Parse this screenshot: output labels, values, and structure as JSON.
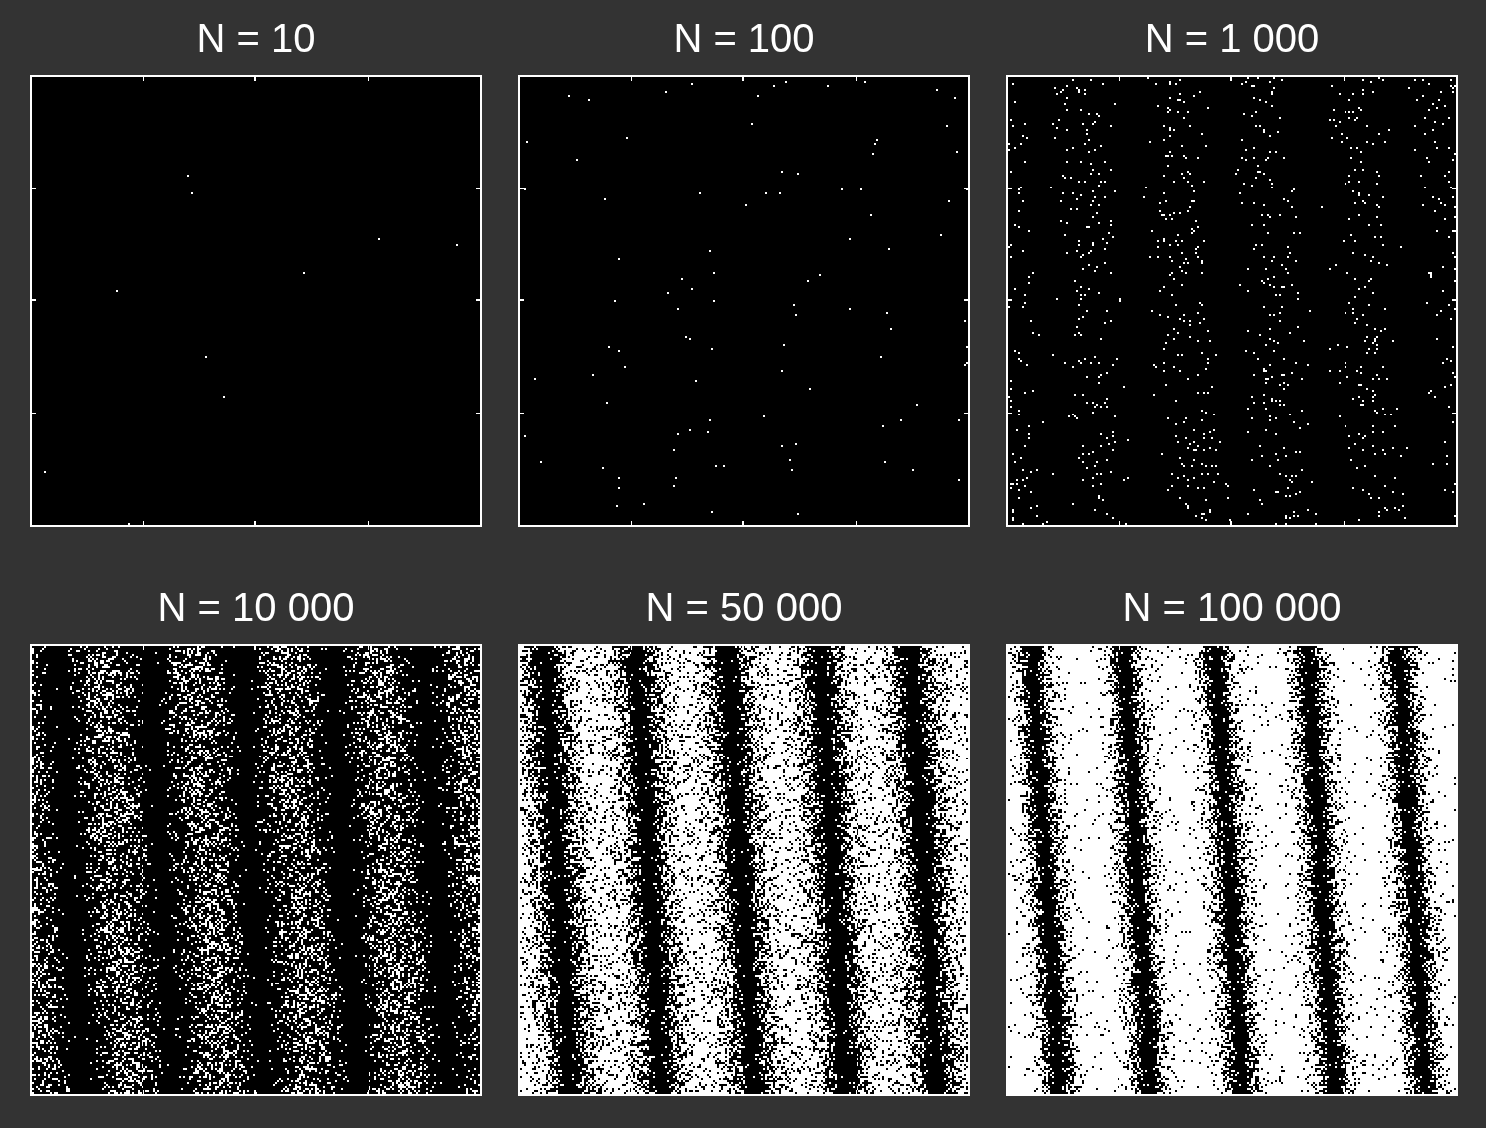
{
  "panels": [
    {
      "title": "N = 10"
    },
    {
      "title": "N = 100"
    },
    {
      "title": "N = 1 000"
    },
    {
      "title": "N = 10 000"
    },
    {
      "title": "N = 50 000"
    },
    {
      "title": "N = 100 000"
    }
  ]
}
